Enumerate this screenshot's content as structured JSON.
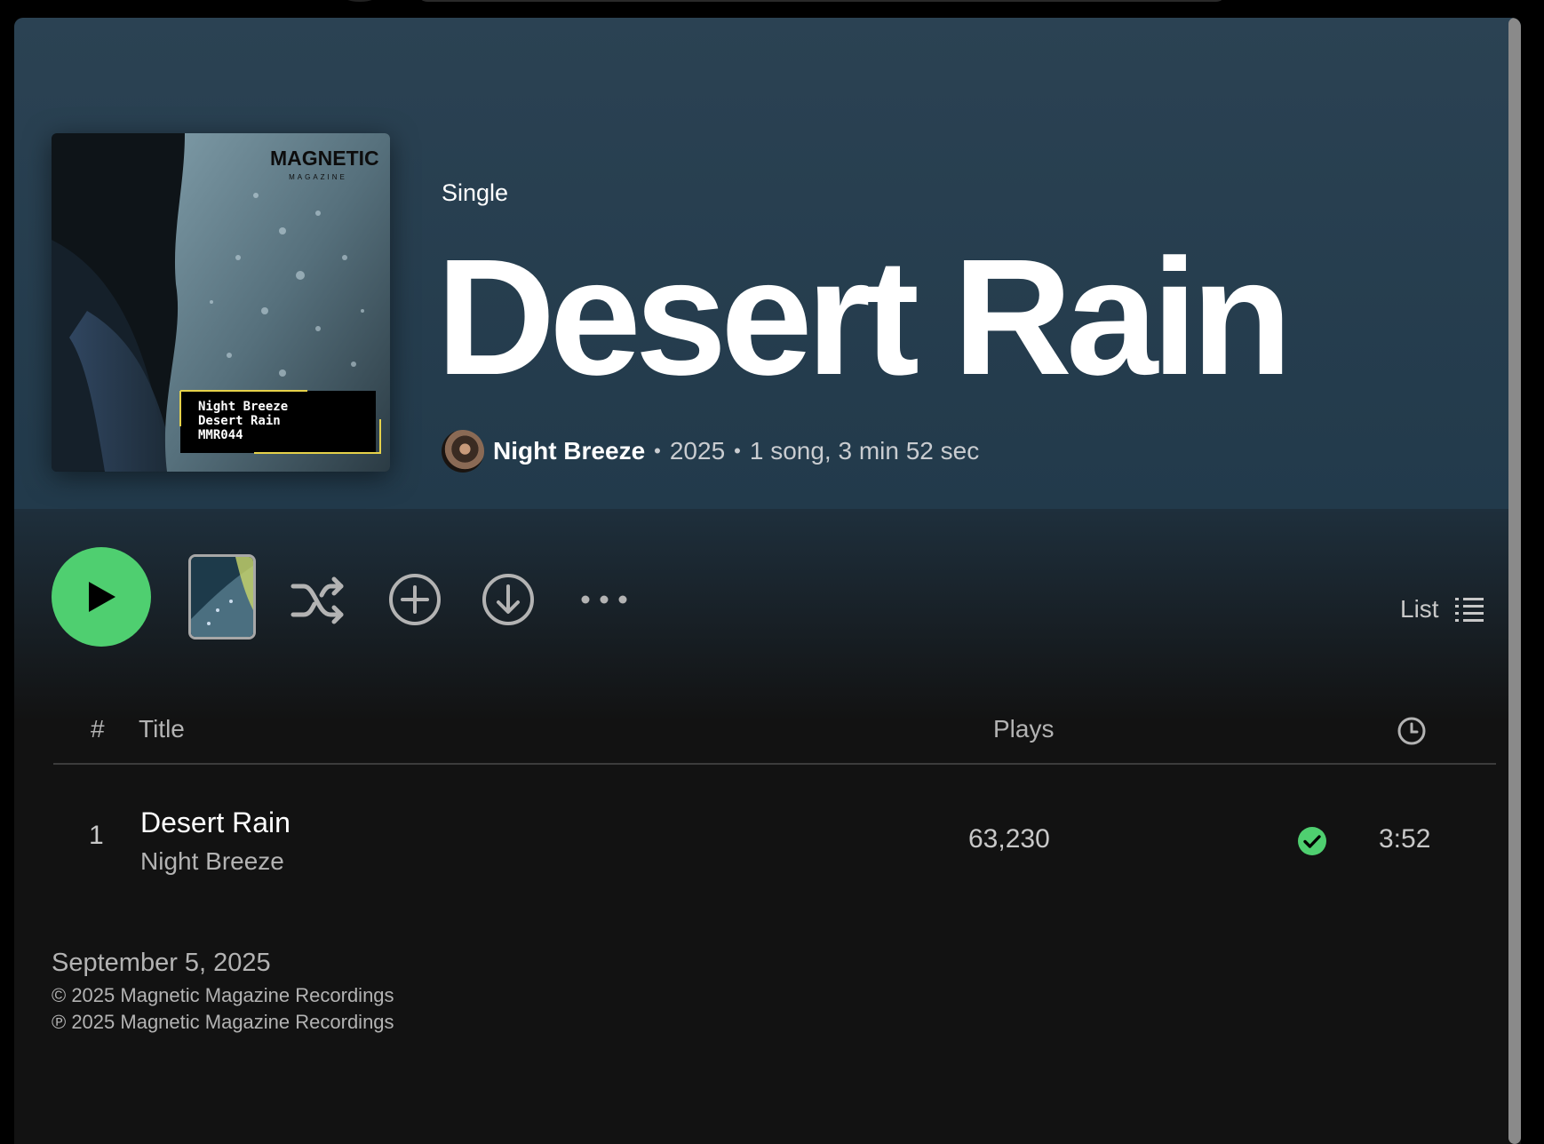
{
  "album": {
    "type": "Single",
    "title": "Desert Rain",
    "artist": "Night Breeze",
    "year": "2025",
    "summary": "1 song, 3 min 52 sec",
    "cover": {
      "brand": "MAGNETIC",
      "brand_sub": "MAGAZINE",
      "label_lines": [
        "Night Breeze",
        "Desert Rain",
        "MMR044"
      ]
    }
  },
  "controls": {
    "play": "play-icon",
    "shuffle": "shuffle-icon",
    "add": "add-circle-icon",
    "download": "download-icon",
    "more": "more-icon",
    "view_label": "List",
    "view_icon": "list-icon"
  },
  "table": {
    "headers": {
      "number": "#",
      "title": "Title",
      "plays": "Plays",
      "duration_icon": "clock-icon"
    },
    "rows": [
      {
        "number": "1",
        "title": "Desert Rain",
        "artist": "Night Breeze",
        "plays": "63,230",
        "saved": true,
        "duration": "3:52"
      }
    ]
  },
  "footer": {
    "release_date": "September 5, 2025",
    "copyright": "© 2025 Magnetic Magazine Recordings",
    "phonographic": "℗ 2025 Magnetic Magazine Recordings"
  },
  "colors": {
    "accent": "#4fcf70",
    "hero_bg": "#2b4253",
    "background": "#121212"
  }
}
